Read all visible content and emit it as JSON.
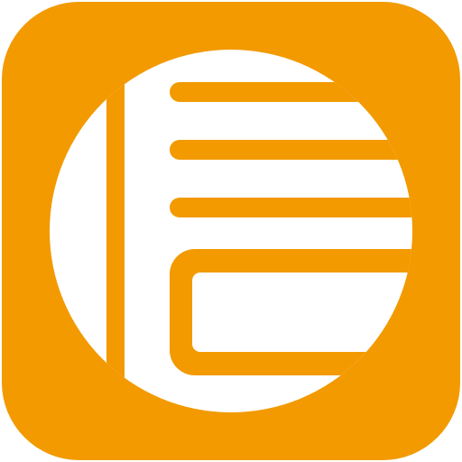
{
  "app_icon": {
    "icon": "document-list-icon",
    "colors": {
      "tile": "#F29A00",
      "glyph": "#FFFFFF",
      "background": "#FFFFFF"
    }
  }
}
